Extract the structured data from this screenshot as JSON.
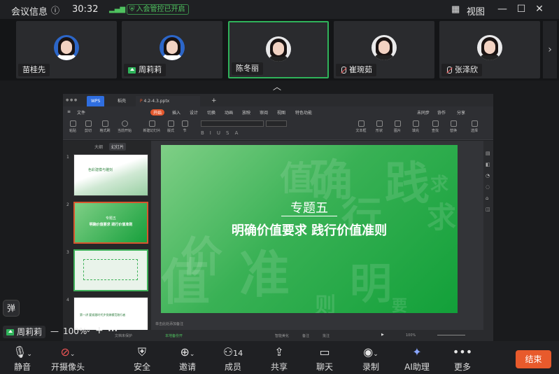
{
  "topbar": {
    "title": "会议信息",
    "info_icon": "ⓘ",
    "time": "30:32",
    "security": "入会管控已开启",
    "view": "视图"
  },
  "participants": [
    {
      "name": "苗桂先",
      "state": "normal",
      "avatar": "blue"
    },
    {
      "name": "周莉莉",
      "state": "sharing",
      "avatar": "blue"
    },
    {
      "name": "陈冬丽",
      "state": "active",
      "avatar": "white"
    },
    {
      "name": "崔琬茹",
      "state": "muted",
      "avatar": "white"
    },
    {
      "name": "张泽欣",
      "state": "muted",
      "avatar": "white"
    }
  ],
  "wps": {
    "tabs": [
      "WPS",
      "稻壳",
      "4.2-4.3.pptx"
    ],
    "menus": [
      "文件",
      "开始",
      "插入",
      "设计",
      "切换",
      "动画",
      "放映",
      "审阅",
      "视图",
      "特色功能",
      "未同步",
      "协作",
      "分享"
    ],
    "ribbon": [
      "粘贴",
      "剪切",
      "复制",
      "格式刷",
      "当前开始",
      "新建幻灯片",
      "版式",
      "节",
      "文本框",
      "形状",
      "排列",
      "图片",
      "填充",
      "轮廓",
      "查找",
      "替换",
      "选择"
    ],
    "panel_tabs": [
      "大纲",
      "幻灯片"
    ],
    "slide_numbers": [
      "1",
      "2",
      "3",
      "4"
    ],
    "thumb1": "色彩建模与雕刻",
    "thumb2_sub": "专题五",
    "thumb2_title": "明确价值要求 践行价值准则",
    "thumb4": "第一讲 要紧跟时代步伐做模范践行者",
    "slide_sub": "专题五",
    "slide_title": "明确价值要求  践行价值准则",
    "bg_chars": [
      "践",
      "求",
      "行",
      "价",
      "值",
      "准",
      "确",
      "明",
      "则",
      "要",
      "求",
      "值"
    ],
    "notes": "单击此处添加备注",
    "status": [
      "文档未保护",
      "本地备份开",
      "智能美化",
      "备注",
      "批注"
    ],
    "zoom": "100%"
  },
  "zoombar": {
    "name": "周莉莉",
    "zoom": "100%",
    "minus": "—",
    "plus": "+",
    "more": "•••"
  },
  "danmu": "弹",
  "toolbar": [
    {
      "label": "静音",
      "icon": "mic-icon",
      "glyph": "🎤"
    },
    {
      "label": "开摄像头",
      "icon": "camera-off-icon",
      "glyph": "⊘"
    },
    {
      "label": "安全",
      "icon": "shield-icon",
      "glyph": "⛨"
    },
    {
      "label": "邀请",
      "icon": "invite-icon",
      "glyph": "👤"
    },
    {
      "label": "成员",
      "icon": "members-icon",
      "glyph": "👥",
      "count": "14"
    },
    {
      "label": "共享",
      "icon": "share-icon",
      "glyph": "⇧"
    },
    {
      "label": "聊天",
      "icon": "chat-icon",
      "glyph": "💬"
    },
    {
      "label": "录制",
      "icon": "record-icon",
      "glyph": "◉"
    },
    {
      "label": "AI助理",
      "icon": "ai-icon",
      "glyph": "✦"
    },
    {
      "label": "更多",
      "icon": "more-icon",
      "glyph": "•••"
    }
  ],
  "end": "结束",
  "colors": {
    "accent": "#2fb35a",
    "end": "#e85a2c",
    "slide": "#39b155"
  }
}
